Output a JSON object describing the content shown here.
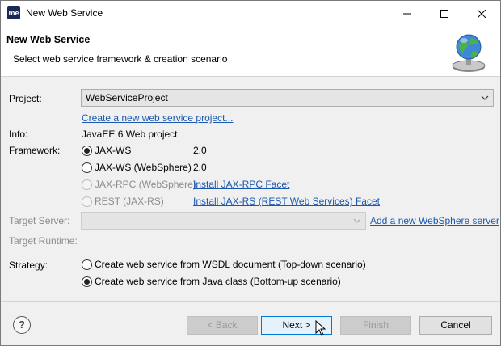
{
  "window": {
    "app_icon_text": "me",
    "title": "New Web Service"
  },
  "banner": {
    "title": "New Web Service",
    "subtitle": "Select web service framework & creation scenario"
  },
  "project": {
    "label": "Project:",
    "value": "WebServiceProject",
    "create_link": "Create a new web service project..."
  },
  "info": {
    "label": "Info:",
    "value": "JavaEE 6 Web project"
  },
  "framework": {
    "label": "Framework:",
    "options": [
      {
        "label": "JAX-WS",
        "version": "2.0",
        "selected": true,
        "enabled": true
      },
      {
        "label": "JAX-WS (WebSphere)",
        "version": "2.0",
        "selected": false,
        "enabled": true
      },
      {
        "label": "JAX-RPC (WebSphere)",
        "link": "Install JAX-RPC Facet",
        "selected": false,
        "enabled": false
      },
      {
        "label": "REST (JAX-RS)",
        "link": "Install JAX-RS (REST Web Services) Facet",
        "selected": false,
        "enabled": false
      }
    ]
  },
  "target_server": {
    "label": "Target Server:",
    "value": "",
    "add_link": "Add a new WebSphere server"
  },
  "target_runtime": {
    "label": "Target Runtime:"
  },
  "strategy": {
    "label": "Strategy:",
    "options": [
      {
        "label": "Create web service from WSDL document (Top-down scenario)",
        "selected": false
      },
      {
        "label": "Create web service from Java class (Bottom-up scenario)",
        "selected": true
      }
    ]
  },
  "buttons": {
    "back": "< Back",
    "next": "Next >",
    "finish": "Finish",
    "cancel": "Cancel",
    "help": "?"
  },
  "colors": {
    "link": "#1a58b0",
    "primary_border": "#0078d7",
    "dialog_bg": "#f0f0f0"
  }
}
